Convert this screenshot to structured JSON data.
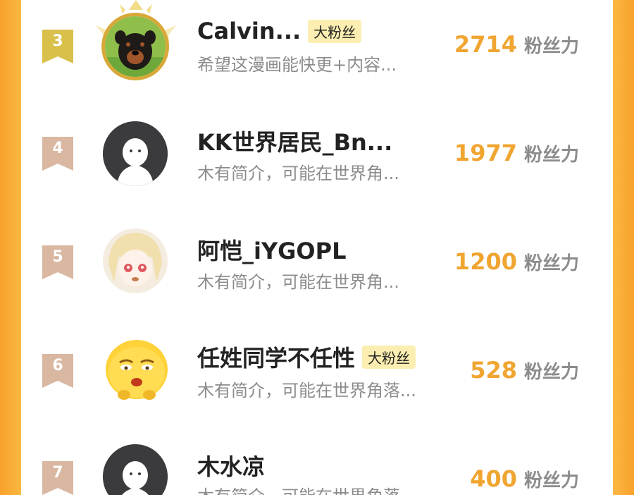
{
  "colors": {
    "background": "#fbb640",
    "panel": "#ffffff",
    "score": "#f0a531",
    "subtext": "#8c8c8c",
    "badge_bg": "#fbeeb0",
    "rank_top": "#d8c04a",
    "rank_other": "#d9b7a1"
  },
  "leaderboard": {
    "rows": [
      {
        "rank": "3",
        "name": "Calvin...",
        "badge": "大粉丝",
        "bio": "希望这漫画能快更+内容...",
        "score": "2714",
        "unit": "粉丝力",
        "avatar": "rottweiler-dog-avatar"
      },
      {
        "rank": "4",
        "name": "KK世界居民_Bn...",
        "badge": "",
        "bio": "木有简介，可能在世界角...",
        "score": "1977",
        "unit": "粉丝力",
        "avatar": "default-ghost-avatar"
      },
      {
        "rank": "5",
        "name": "阿恺_iYGOPL",
        "badge": "",
        "bio": "木有简介，可能在世界角...",
        "score": "1200",
        "unit": "粉丝力",
        "avatar": "anime-girl-avatar"
      },
      {
        "rank": "6",
        "name": "任姓同学不任性",
        "badge": "大粉丝",
        "bio": "木有简介，可能在世界角落...",
        "score": "528",
        "unit": "粉丝力",
        "avatar": "yellow-emoji-avatar"
      },
      {
        "rank": "7",
        "name": "木水凉",
        "badge": "",
        "bio": "木有简介，可能在世界角落...",
        "score": "400",
        "unit": "粉丝力",
        "avatar": "default-ghost-avatar"
      }
    ]
  }
}
